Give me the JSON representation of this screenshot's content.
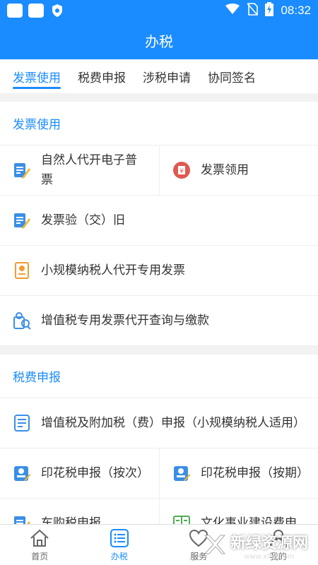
{
  "status_bar": {
    "time": "08:32"
  },
  "header": {
    "title": "办税"
  },
  "tabs": [
    {
      "label": "发票使用",
      "active": true
    },
    {
      "label": "税费申报",
      "active": false
    },
    {
      "label": "涉税申请",
      "active": false
    },
    {
      "label": "协同签名",
      "active": false
    }
  ],
  "sections": [
    {
      "title": "发票使用",
      "items": [
        {
          "label": "自然人代开电子普票",
          "icon": "edit-doc-icon"
        },
        {
          "label": "发票领用",
          "icon": "invoice-pickup-icon"
        },
        {
          "label": "发票验（交）旧",
          "icon": "edit-doc-icon"
        },
        {
          "label": "小规模纳税人代开专用发票",
          "icon": "certificate-icon"
        },
        {
          "label": "增值税专用发票代开查询与缴款",
          "icon": "search-pay-icon"
        }
      ]
    },
    {
      "title": "税费申报",
      "items": [
        {
          "label": "增值税及附加税（费）申报（小规模纳税人适用）",
          "icon": "declaration-form-icon"
        },
        {
          "label": "印花税申报（按次）",
          "icon": "stamp-per-time-icon"
        },
        {
          "label": "印花税申报（按期）",
          "icon": "stamp-per-period-icon"
        },
        {
          "label": "车购税申报",
          "icon": "edit-doc-icon"
        },
        {
          "label": "文化事业建设费申",
          "icon": "book-icon"
        }
      ]
    }
  ],
  "bottom_nav": [
    {
      "label": "首页",
      "icon": "home-icon",
      "active": false
    },
    {
      "label": "办税",
      "icon": "list-icon",
      "active": true
    },
    {
      "label": "服务",
      "icon": "heart-icon",
      "active": false
    },
    {
      "label": "我的",
      "icon": "user-icon",
      "active": false
    }
  ],
  "watermark": {
    "title": "新绿资源网",
    "url": "www.xlhs.com"
  },
  "colors": {
    "primary": "#1a8cff",
    "icon_blue": "#3a8ee6",
    "icon_orange": "#f29b34",
    "icon_red": "#e05a4f",
    "icon_green": "#4caf50"
  }
}
